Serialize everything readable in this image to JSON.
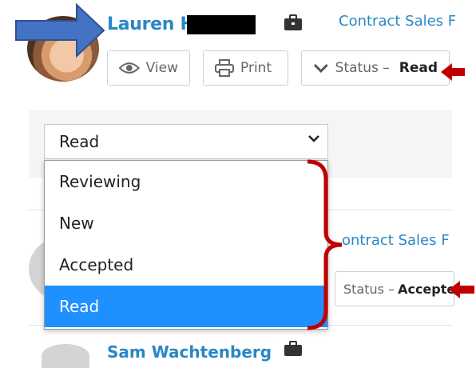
{
  "candidate": {
    "name": "Lauren H",
    "job": "Contract Sales F",
    "buttons": {
      "view": "View",
      "print": "Print",
      "status_prefix": "Status –",
      "status_value": "Read"
    }
  },
  "status_select": {
    "value": "Read",
    "options": [
      "Reviewing",
      "New",
      "Accepted",
      "Read"
    ],
    "selected_index": 3
  },
  "candidate2": {
    "job": "ontract Sales F",
    "status_prefix": "Status –",
    "status_value": "Accepte"
  },
  "candidate3": {
    "name": "Sam Wachtenberg"
  },
  "colors": {
    "link": "#2a87c5",
    "selected_option": "#1e90ff",
    "annotation_arrow_blue": "#4472c4",
    "annotation_red": "#c00000"
  },
  "icons": {
    "view": "eye-icon",
    "print": "printer-icon",
    "status": "chevron-down-icon",
    "job": "briefcase-icon"
  }
}
